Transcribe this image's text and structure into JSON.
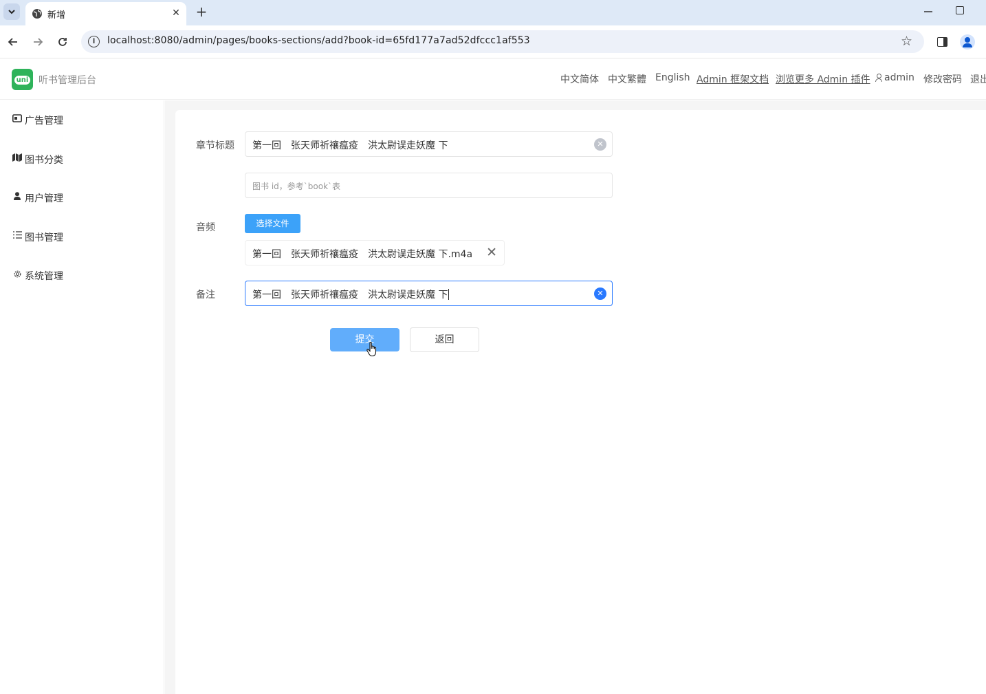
{
  "browser": {
    "tab_title": "新增",
    "url": "localhost:8080/admin/pages/books-sections/add?book-id=65fd177a7ad52dfccc1af553"
  },
  "header": {
    "logo_text": "uni",
    "app_title": "听书管理后台",
    "nav": {
      "zh_hans": "中文简体",
      "zh_hant": "中文繁體",
      "english": "English",
      "docs": "Admin 框架文档",
      "plugins": "浏览更多 Admin 插件",
      "user": "admin",
      "change_password": "修改密码",
      "logout": "退出"
    }
  },
  "sidebar": {
    "items": [
      {
        "label": "广告管理",
        "icon": "ad-icon"
      },
      {
        "label": "图书分类",
        "icon": "map-icon"
      },
      {
        "label": "用户管理",
        "icon": "user-icon"
      },
      {
        "label": "图书管理",
        "icon": "list-icon"
      },
      {
        "label": "系统管理",
        "icon": "gear-icon"
      }
    ]
  },
  "form": {
    "title_label": "章节标题",
    "title_value": "第一回　张天师祈禳瘟疫　洪太尉误走妖魔 下",
    "book_id_placeholder": "图书 id，参考`book`表",
    "audio_label": "音频",
    "choose_file_label": "选择文件",
    "file_name": "第一回　张天师祈禳瘟疫　洪太尉误走妖魔 下.m4a",
    "remark_label": "备注",
    "remark_value": "第一回　张天师祈禳瘟疫　洪太尉误走妖魔 下",
    "submit_label": "提交",
    "back_label": "返回"
  },
  "colors": {
    "primary": "#2979ff",
    "file_button": "#3ca2f9",
    "submit_button": "#61adfb",
    "logo": "#2eb35a"
  }
}
